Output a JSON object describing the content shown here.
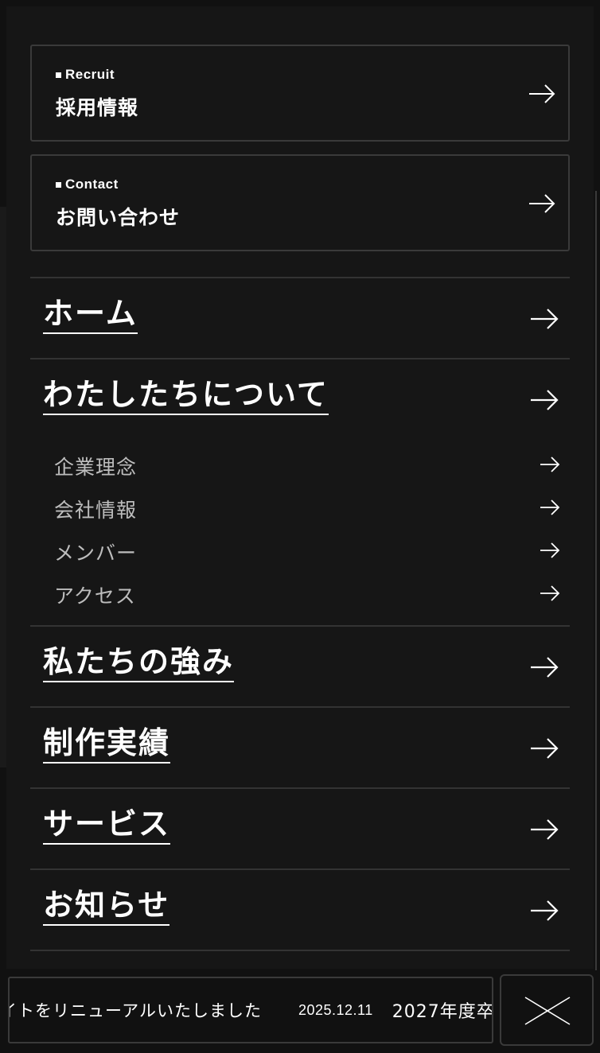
{
  "cards": [
    {
      "en": "Recruit",
      "ja": "採用情報"
    },
    {
      "en": "Contact",
      "ja": "お問い合わせ"
    }
  ],
  "nav": {
    "home": "ホーム",
    "about": "わたしたちについて",
    "about_sub": [
      "企業理念",
      "会社情報",
      "メンバー",
      "アクセス"
    ],
    "strengths": "私たちの強み",
    "works": "制作実績",
    "services": "サービス",
    "news": "お知らせ"
  },
  "ticker": {
    "text1": "イトをリニューアルいたしました",
    "date": "2025.12.11",
    "text2": "2027年度卒"
  },
  "icons": {
    "arrow": "arrow-right-icon",
    "close": "close-icon"
  },
  "colors": {
    "background": "#111111",
    "panel": "#161616",
    "border": "#3a3a3a",
    "sub_text": "#bdbdbd"
  }
}
